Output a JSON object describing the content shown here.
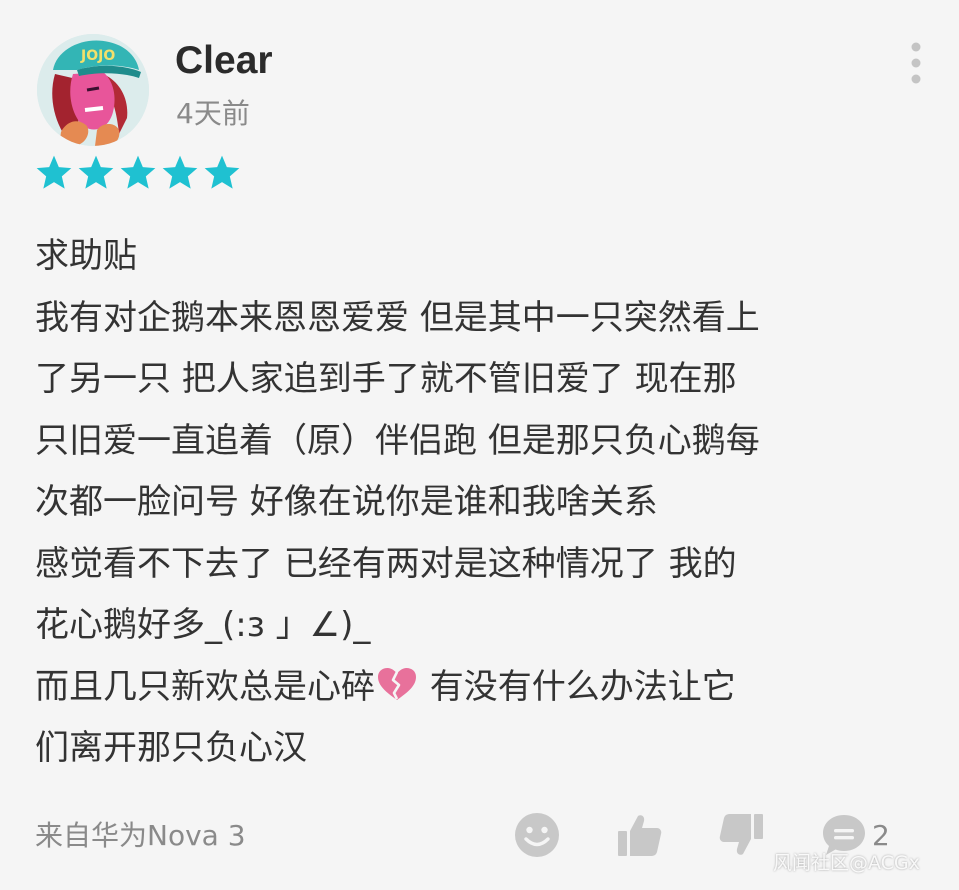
{
  "header": {
    "username": "Clear",
    "time": "4天前",
    "rating": 5,
    "more_icon": "more-vertical-icon"
  },
  "colors": {
    "star": "#1fc1d1",
    "heart": "#e8719b",
    "secondary_text": "#8a8a8a",
    "icon_gray": "#c8c8c8"
  },
  "review": {
    "lines": [
      {
        "text": "求助贴"
      },
      {
        "text": "我有对企鹅本来恩恩爱爱 但是其中一只突然看上"
      },
      {
        "text": "了另一只 把人家追到手了就不管旧爱了 现在那"
      },
      {
        "text": "只旧爱一直追着（原）伴侣跑 但是那只负心鹅每"
      },
      {
        "text": "次都一脸问号 好像在说你是谁和我啥关系"
      },
      {
        "text": "感觉看不下去了 已经有两对是这种情况了 我的"
      },
      {
        "text": "花心鹅好多_(:з 」∠)_"
      },
      {
        "text": "而且几只新欢总是心碎",
        "emoji": "broken-heart-icon",
        "text_after": " 有没有什么办法让它"
      },
      {
        "text": "们离开那只负心汉"
      }
    ]
  },
  "footer": {
    "device": "来自华为Nova 3",
    "actions": [
      {
        "name": "emoji-react-button",
        "icon": "smiley-icon"
      },
      {
        "name": "like-button",
        "icon": "thumbs-up-icon"
      },
      {
        "name": "dislike-button",
        "icon": "thumbs-down-icon"
      },
      {
        "name": "comment-button",
        "icon": "comment-icon"
      }
    ],
    "comment_count": "2"
  },
  "watermark": "风闻社区@ACGx"
}
